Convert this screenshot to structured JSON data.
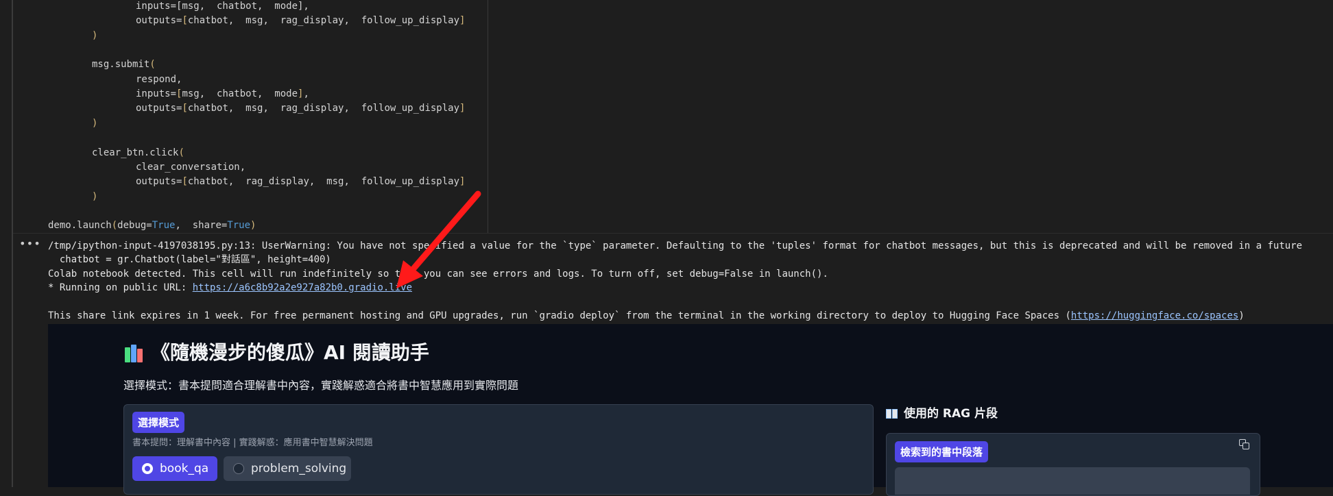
{
  "code": {
    "lines": [
      {
        "indent": 2,
        "segments": [
          {
            "t": "inputs=[msg,  chatbot,  mode],",
            "c": ""
          }
        ]
      },
      {
        "indent": 2,
        "segments": [
          {
            "t": "outputs=",
            "c": ""
          },
          {
            "t": "[",
            "c": "br"
          },
          {
            "t": "chatbot,  msg,  rag_display,  follow_up_display",
            "c": ""
          },
          {
            "t": "]",
            "c": "br"
          }
        ]
      },
      {
        "indent": 1,
        "segments": [
          {
            "t": ")",
            "c": "br"
          }
        ]
      },
      {
        "indent": 0,
        "segments": []
      },
      {
        "indent": 1,
        "segments": [
          {
            "t": "msg.submit",
            "c": ""
          },
          {
            "t": "(",
            "c": "br"
          }
        ]
      },
      {
        "indent": 2,
        "segments": [
          {
            "t": "respond,",
            "c": ""
          }
        ]
      },
      {
        "indent": 2,
        "segments": [
          {
            "t": "inputs=",
            "c": ""
          },
          {
            "t": "[",
            "c": "br"
          },
          {
            "t": "msg,  chatbot,  mode",
            "c": ""
          },
          {
            "t": "]",
            "c": "br"
          },
          {
            "t": ",",
            "c": ""
          }
        ]
      },
      {
        "indent": 2,
        "segments": [
          {
            "t": "outputs=",
            "c": ""
          },
          {
            "t": "[",
            "c": "br"
          },
          {
            "t": "chatbot,  msg,  rag_display,  follow_up_display",
            "c": ""
          },
          {
            "t": "]",
            "c": "br"
          }
        ]
      },
      {
        "indent": 1,
        "segments": [
          {
            "t": ")",
            "c": "br"
          }
        ]
      },
      {
        "indent": 0,
        "segments": []
      },
      {
        "indent": 1,
        "segments": [
          {
            "t": "clear_btn.click",
            "c": ""
          },
          {
            "t": "(",
            "c": "br"
          }
        ]
      },
      {
        "indent": 2,
        "segments": [
          {
            "t": "clear_conversation,",
            "c": ""
          }
        ]
      },
      {
        "indent": 2,
        "segments": [
          {
            "t": "outputs=",
            "c": ""
          },
          {
            "t": "[",
            "c": "br"
          },
          {
            "t": "chatbot,  rag_display,  msg,  follow_up_display",
            "c": ""
          },
          {
            "t": "]",
            "c": "br"
          }
        ]
      },
      {
        "indent": 1,
        "segments": [
          {
            "t": ")",
            "c": "br"
          }
        ]
      },
      {
        "indent": 0,
        "segments": []
      },
      {
        "indent": 0,
        "segments": [
          {
            "t": "demo.launch",
            "c": ""
          },
          {
            "t": "(",
            "c": "br"
          },
          {
            "t": "debug=",
            "c": ""
          },
          {
            "t": "True",
            "c": "kw"
          },
          {
            "t": ",  share=",
            "c": ""
          },
          {
            "t": "True",
            "c": "kw"
          },
          {
            "t": ")",
            "c": "br"
          }
        ]
      }
    ]
  },
  "output": {
    "more_icon": "ellipsis-icon",
    "line1": "/tmp/ipython-input-4197038195.py:13: UserWarning: You have not specified a value for the `type` parameter. Defaulting to the 'tuples' format for chatbot messages, but this is deprecated and will be removed in a future",
    "line2": "  chatbot = gr.Chatbot(label=\"對話區\", height=400)",
    "line3": "Colab notebook detected. This cell will run indefinitely so that you can see errors and logs. To turn off, set debug=False in launch().",
    "line4_prefix": "* Running on public URL: ",
    "public_url": "https://a6c8b92a2e927a82b0.gradio.live",
    "line5_prefix": "This share link expires in 1 week. For free permanent hosting and GPU upgrades, run `gradio deploy` from the terminal in the working directory to deploy to Hugging Face Spaces (",
    "spaces_url": "https://huggingface.co/spaces",
    "line5_suffix": ")"
  },
  "gradio": {
    "title": "《隨機漫步的傻瓜》AI 閱讀助手",
    "title_icon": "books-icon",
    "subtitle": "選擇模式：書本提問適合理解書中內容，實踐解惑適合將書中智慧應用到實際問題",
    "mode_panel": {
      "label": "選擇模式",
      "info": "書本提問：理解書中內容 | 實踐解惑：應用書中智慧解決問題",
      "options": [
        "book_qa",
        "problem_solving"
      ],
      "selected": "book_qa"
    },
    "rag": {
      "icon": "open-book-icon",
      "title": "使用的 RAG 片段",
      "label": "檢索到的書中段落",
      "copy_icon": "copy-icon"
    }
  },
  "annotation": {
    "color": "#ff1a1a"
  },
  "colors": {
    "accent": "#4f46e5",
    "link": "#9cc5ff",
    "background": "#1e1e1e",
    "gradio_bg": "#0b0f19"
  }
}
